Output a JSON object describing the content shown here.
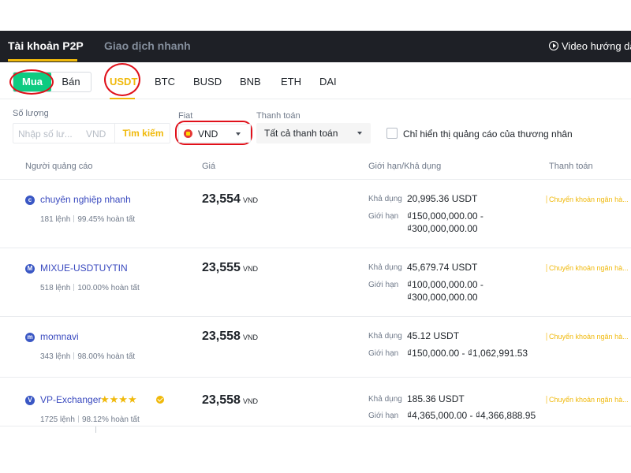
{
  "header": {
    "tab_active": "Tài khoản P2P",
    "tab_inactive": "Giao dịch nhanh",
    "video_label": "Video hướng dẫ"
  },
  "toggle": {
    "buy": "Mua",
    "sell": "Bán"
  },
  "coins": [
    "USDT",
    "BTC",
    "BUSD",
    "BNB",
    "ETH",
    "DAI"
  ],
  "filters": {
    "amount_label": "Số lượng",
    "amount_placeholder": "Nhập số lư...",
    "amount_unit": "VND",
    "search_button": "Tìm kiếm",
    "fiat_label": "Fiat",
    "fiat_value": "VND",
    "payment_label": "Thanh toán",
    "payment_value": "Tất cả thanh toán",
    "merchant_only_label": "Chỉ hiển thị quảng cáo của thương nhân"
  },
  "table": {
    "headers": [
      "Người quảng cáo",
      "Giá",
      "Giới hạn/Khả dụng",
      "Thanh toán"
    ],
    "available_label": "Khả dụng",
    "limit_label": "Giới hạn",
    "rows": [
      {
        "avatar": "c",
        "name": "chuyên nghiệp nhanh",
        "orders": "181 lệnh",
        "completion": "99.45% hoàn tất",
        "price": "23,554",
        "currency": "VND",
        "available": "20,995.36 USDT",
        "limit_line1": "₫150,000,000.00 -",
        "limit_line2": "₫300,000,000.00",
        "payment": "Chuyển khoản ngân hà..."
      },
      {
        "avatar": "M",
        "name": "MIXUE-USDTUYTIN",
        "orders": "518 lệnh",
        "completion": "100.00% hoàn tất",
        "price": "23,555",
        "currency": "VND",
        "available": "45,679.74 USDT",
        "limit_line1": "₫100,000,000.00 -",
        "limit_line2": "₫300,000,000.00",
        "payment": "Chuyển khoản ngân hà..."
      },
      {
        "avatar": "m",
        "name": "momnavi",
        "orders": "343 lệnh",
        "completion": "98.00% hoàn tất",
        "price": "23,558",
        "currency": "VND",
        "available": "45.12 USDT",
        "limit_line1": "₫150,000.00 - ₫1,062,991.53",
        "limit_line2": "",
        "payment": "Chuyển khoản ngân hà..."
      },
      {
        "avatar": "V",
        "name": "VP-Exchanger",
        "stars": "★★★★",
        "orders": "1725 lệnh",
        "completion": "98.12% hoàn tất",
        "price": "23,558",
        "currency": "VND",
        "available": "185.36 USDT",
        "limit_line1": "₫4,365,000.00 - ₫4,366,888.95",
        "limit_line2": "",
        "payment": "Chuyển khoản ngân hà..."
      }
    ]
  },
  "colors": {
    "accent": "#f0b90b",
    "buy_green": "#0ecb81",
    "annotation_red": "#e0101a",
    "header_bg": "#1e2026"
  }
}
